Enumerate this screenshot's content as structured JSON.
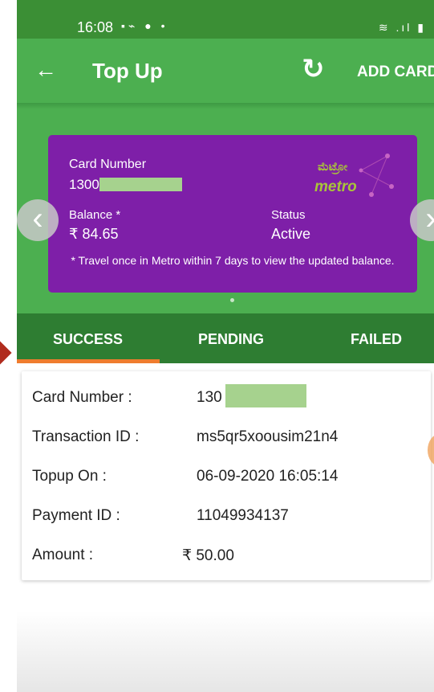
{
  "status_bar": {
    "time": "16:08",
    "left_icons": "▪⌁ ●  •",
    "right_icons": "≋ .ıl ▮"
  },
  "app_bar": {
    "title": "Top Up",
    "add_card_label": "ADD CARD",
    "back_icon": "arrow-left",
    "refresh_icon": "refresh"
  },
  "card": {
    "card_number_label": "Card Number",
    "card_number": "1300",
    "balance_label": "Balance *",
    "balance": "₹ 84.65",
    "status_label": "Status",
    "status": "Active",
    "note": "* Travel once in Metro within 7 days to view the updated balance.",
    "logo_text": "metro",
    "color": "#7e1fa8"
  },
  "tabs": [
    {
      "label": "SUCCESS",
      "active": true
    },
    {
      "label": "PENDING",
      "active": false
    },
    {
      "label": "FAILED",
      "active": false
    }
  ],
  "transaction": {
    "rows": [
      {
        "label": "Card Number :",
        "value": "130"
      },
      {
        "label": "Transaction ID :",
        "value": "ms5qr5xoousim21n4"
      },
      {
        "label": "Topup On :",
        "value": "06-09-2020 16:05:14"
      },
      {
        "label": "Payment ID :",
        "value": "11049934137"
      },
      {
        "label": "Amount :",
        "value": "₹ 50.00"
      }
    ]
  },
  "colors": {
    "primary": "#4caf50",
    "primary_dark": "#2e7d32",
    "tab_indicator": "#ef7c2e",
    "mask": "#a6d28e"
  }
}
